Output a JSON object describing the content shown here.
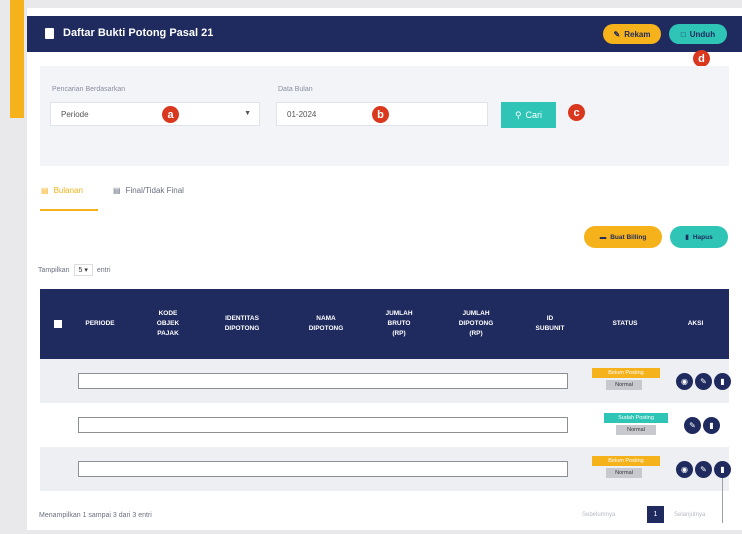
{
  "header": {
    "title": "Daftar Bukti Potong Pasal 21",
    "rekam_label": "Rekam",
    "unduh_label": "Unduh"
  },
  "search": {
    "by_label": "Pencarian Berdasarkan",
    "by_value": "Periode",
    "date_label": "Data Bulan",
    "date_value": "01-2024",
    "cari_label": "Cari"
  },
  "tabs": [
    {
      "label": "Bulanan",
      "active": true
    },
    {
      "label": "Final/Tidak Final",
      "active": false
    }
  ],
  "actions": {
    "buat_billing": "Buat Billing",
    "hapus": "Hapus"
  },
  "show": {
    "prefix": "Tampilkan",
    "value": "5",
    "suffix": "entri"
  },
  "table": {
    "columns": [
      "PERIODE",
      "KODE\nOBJEK\nPAJAK",
      "IDENTITAS\nDIPOTONG",
      "NAMA\nDIPOTONG",
      "JUMLAH\nBRUTO\n(RP)",
      "JUMLAH\nDIPOTONG\n(RP)",
      "ID\nSUBUNIT",
      "STATUS",
      "AKSI"
    ],
    "rows": [
      {
        "status": "Belum Posting",
        "status_color": "#f6b21b",
        "sub": "Normal",
        "actions": [
          "eye-icon",
          "edit-icon",
          "trash-icon"
        ]
      },
      {
        "status": "Sudah Posting",
        "status_color": "#2ec5b6",
        "sub": "Normal",
        "actions": [
          "edit-icon",
          "trash-icon"
        ]
      },
      {
        "status": "Belum Posting",
        "status_color": "#f6b21b",
        "sub": "Normal",
        "actions": [
          "eye-icon",
          "edit-icon",
          "trash-icon"
        ]
      }
    ]
  },
  "badges": [
    "a",
    "b",
    "c",
    "d"
  ],
  "footer": {
    "summary": "Menampilkan 1 sampai 3 dari 3 entri",
    "prev": "Sebelumnya",
    "current_page": "1",
    "next": "Selanjutnya"
  },
  "colors": {
    "navy": "#1f2a5e",
    "accent": "#f6b21b",
    "teal": "#2ec5b6",
    "badge": "#d9371e"
  }
}
